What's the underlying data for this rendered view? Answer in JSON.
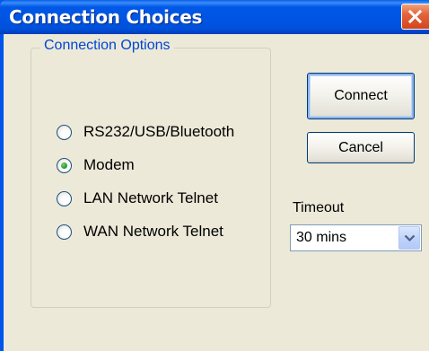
{
  "window": {
    "title": "Connection Choices"
  },
  "connection_options": {
    "label": "Connection Options",
    "options": [
      {
        "label": "RS232/USB/Bluetooth",
        "selected": false
      },
      {
        "label": "Modem",
        "selected": true
      },
      {
        "label": "LAN Network Telnet",
        "selected": false
      },
      {
        "label": "WAN Network Telnet",
        "selected": false
      }
    ]
  },
  "buttons": {
    "connect": "Connect",
    "cancel": "Cancel"
  },
  "timeout": {
    "label": "Timeout",
    "value": "30 mins"
  },
  "icons": {
    "close": "close-icon",
    "dropdown": "chevron-down-icon"
  },
  "colors": {
    "titlebar": "#0054e3",
    "close_button": "#e3643c",
    "group_label": "#0046d5",
    "window_face": "#ece9d8"
  }
}
